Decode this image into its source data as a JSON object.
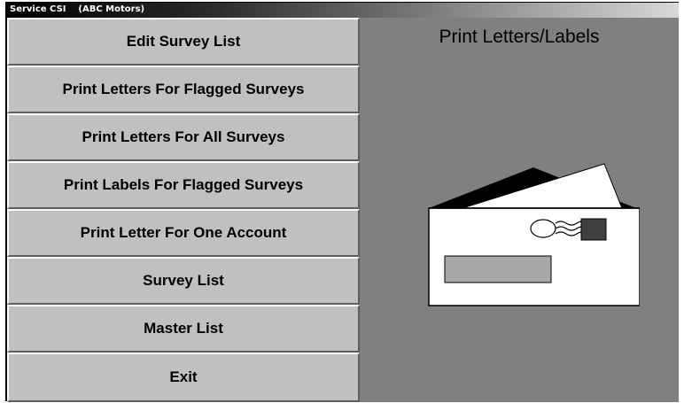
{
  "window": {
    "title": "Service CSI    (ABC Motors)"
  },
  "menu": {
    "items": [
      {
        "label": "Edit Survey List"
      },
      {
        "label": "Print Letters For Flagged Surveys"
      },
      {
        "label": "Print Letters For All Surveys"
      },
      {
        "label": "Print Labels For Flagged Surveys"
      },
      {
        "label": "Print Letter For One Account"
      },
      {
        "label": "Survey List"
      },
      {
        "label": "Master List"
      },
      {
        "label": "Exit"
      }
    ]
  },
  "panel": {
    "title": "Print Letters/Labels",
    "illustration": "envelope-icon"
  },
  "colors": {
    "menu_bg": "#c0c0c0",
    "panel_bg": "#808080",
    "titlebar_start": "#000000",
    "titlebar_end": "#d8d8d8"
  }
}
